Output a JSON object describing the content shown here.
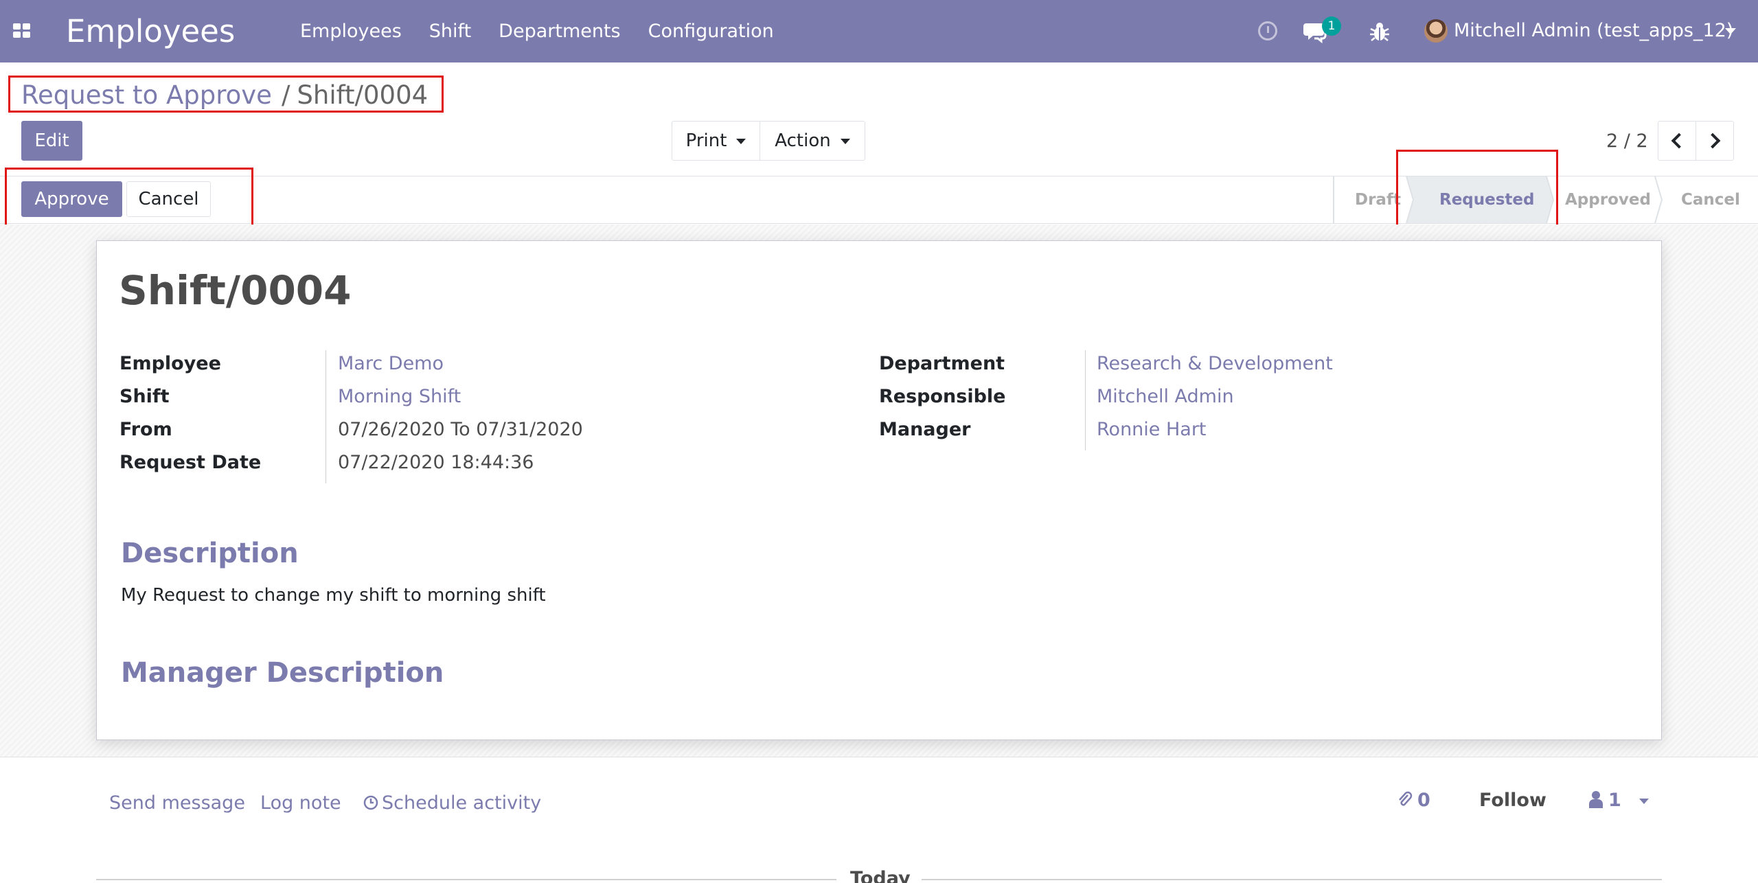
{
  "navbar": {
    "brand": "Employees",
    "menu": [
      "Employees",
      "Shift",
      "Departments",
      "Configuration"
    ],
    "chat_badge": "1",
    "user_name": "Mitchell Admin (test_apps_12)",
    "bg_color": "#7c7bad"
  },
  "breadcrumb": {
    "parent": "Request to Approve",
    "separator": "/",
    "current": "Shift/0004"
  },
  "control_panel": {
    "edit_label": "Edit",
    "print_label": "Print",
    "action_label": "Action",
    "pager": "2 / 2"
  },
  "statusbar": {
    "approve_label": "Approve",
    "cancel_label": "Cancel",
    "stages": [
      "Draft",
      "Requested",
      "Approved",
      "Cancel"
    ],
    "active_stage": "Requested"
  },
  "record": {
    "name": "Shift/0004",
    "left_fields": [
      {
        "label": "Employee",
        "value": "Marc Demo",
        "is_link": true
      },
      {
        "label": "Shift",
        "value": "Morning Shift",
        "is_link": true
      },
      {
        "label": "From",
        "value": "07/26/2020 To 07/31/2020",
        "is_link": false
      },
      {
        "label": "Request Date",
        "value": "07/22/2020 18:44:36",
        "is_link": false
      }
    ],
    "right_fields": [
      {
        "label": "Department",
        "value": "Research & Development",
        "is_link": true
      },
      {
        "label": "Responsible",
        "value": "Mitchell Admin",
        "is_link": true
      },
      {
        "label": "Manager",
        "value": "Ronnie Hart",
        "is_link": true
      }
    ],
    "description_title": "Description",
    "description_text": "My Request to change my shift to morning shift",
    "manager_description_title": "Manager Description"
  },
  "chatter": {
    "send_message": "Send message",
    "log_note": "Log note",
    "schedule_activity": "Schedule activity",
    "attachments_count": "0",
    "follow_label": "Follow",
    "followers_count": "1",
    "today_label": "Today"
  },
  "colors": {
    "accent": "#7c7bad",
    "highlight_box": "#e01616",
    "badge": "#00a09d"
  }
}
